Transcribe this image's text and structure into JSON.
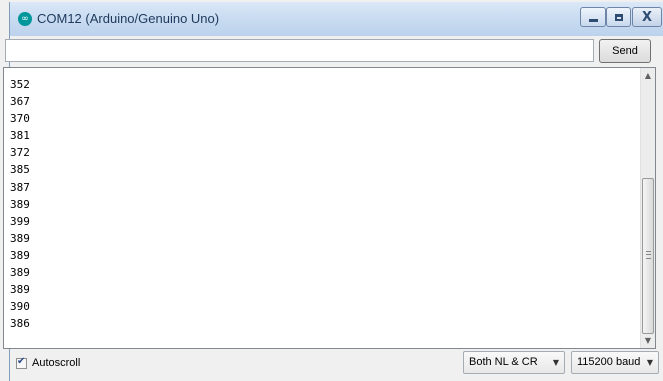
{
  "window": {
    "title": "COM12 (Arduino/Genuino Uno)",
    "icon": "arduino-logo-icon",
    "controls": {
      "minimize": "minimize-icon",
      "maximize": "maximize-icon",
      "close": "close-icon",
      "close_glyph": "X"
    }
  },
  "input_bar": {
    "value": "",
    "placeholder": "",
    "send_label": "Send"
  },
  "output": {
    "lines": [
      "352",
      "367",
      "370",
      "381",
      "372",
      "385",
      "387",
      "389",
      "399",
      "389",
      "389",
      "389",
      "389",
      "390",
      "386"
    ]
  },
  "footer": {
    "autoscroll_label": "Autoscroll",
    "autoscroll_checked": true,
    "line_ending": "Both NL & CR",
    "baud_rate": "115200 baud"
  },
  "colors": {
    "titlebar": "#c5d9f0",
    "arduino_teal": "#00979c"
  }
}
